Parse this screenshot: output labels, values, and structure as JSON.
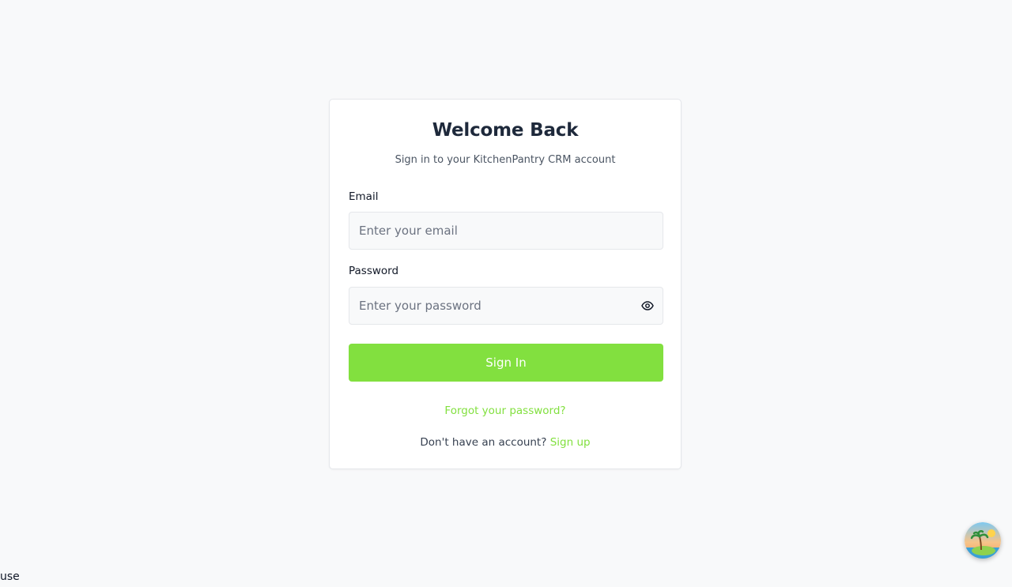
{
  "login": {
    "title": "Welcome Back",
    "subtitle": "Sign in to your KitchenPantry CRM account",
    "email_label": "Email",
    "email_placeholder": "Enter your email",
    "email_value": "",
    "password_label": "Password",
    "password_placeholder": "Enter your password",
    "password_value": "",
    "submit_label": "Sign In",
    "forgot_link": "Forgot your password?",
    "signup_prompt": "Don't have an account?",
    "signup_link": "Sign up"
  },
  "footer": {
    "corner_text": "use"
  },
  "icons": {
    "password_toggle": "eye-icon",
    "assistant": "palm-island-icon"
  },
  "colors": {
    "accent": "#82e03f",
    "background": "#f8f9fa",
    "card": "#ffffff",
    "title_text": "#1e293b"
  }
}
